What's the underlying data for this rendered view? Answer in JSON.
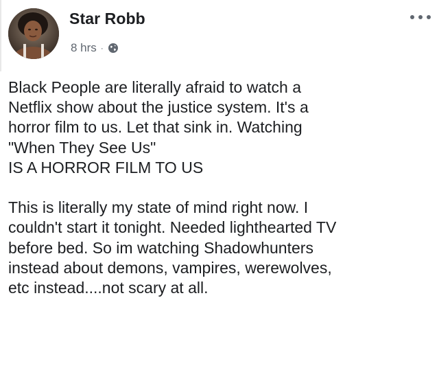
{
  "post": {
    "author": "Star Robb",
    "timestamp": "8 hrs",
    "separator": "·",
    "privacy_icon": "globe-icon",
    "menu_icon": "more-options-icon",
    "paragraph1": [
      "Black People are literally afraid to watch a",
      "Netflix show about the justice system. It's a",
      "horror film to us. Let that sink in. Watching",
      "\"When They See Us\"",
      "IS A HORROR FILM TO US"
    ],
    "paragraph2": [
      "This is literally my state of mind right now. I",
      "couldn't start it tonight. Needed lighthearted TV",
      "before bed. So im watching Shadowhunters",
      "instead about demons, vampires,  werewolves,",
      "etc instead....not scary at all."
    ]
  },
  "colors": {
    "text": "#1c1e21",
    "meta": "#606770",
    "background": "#ffffff"
  }
}
